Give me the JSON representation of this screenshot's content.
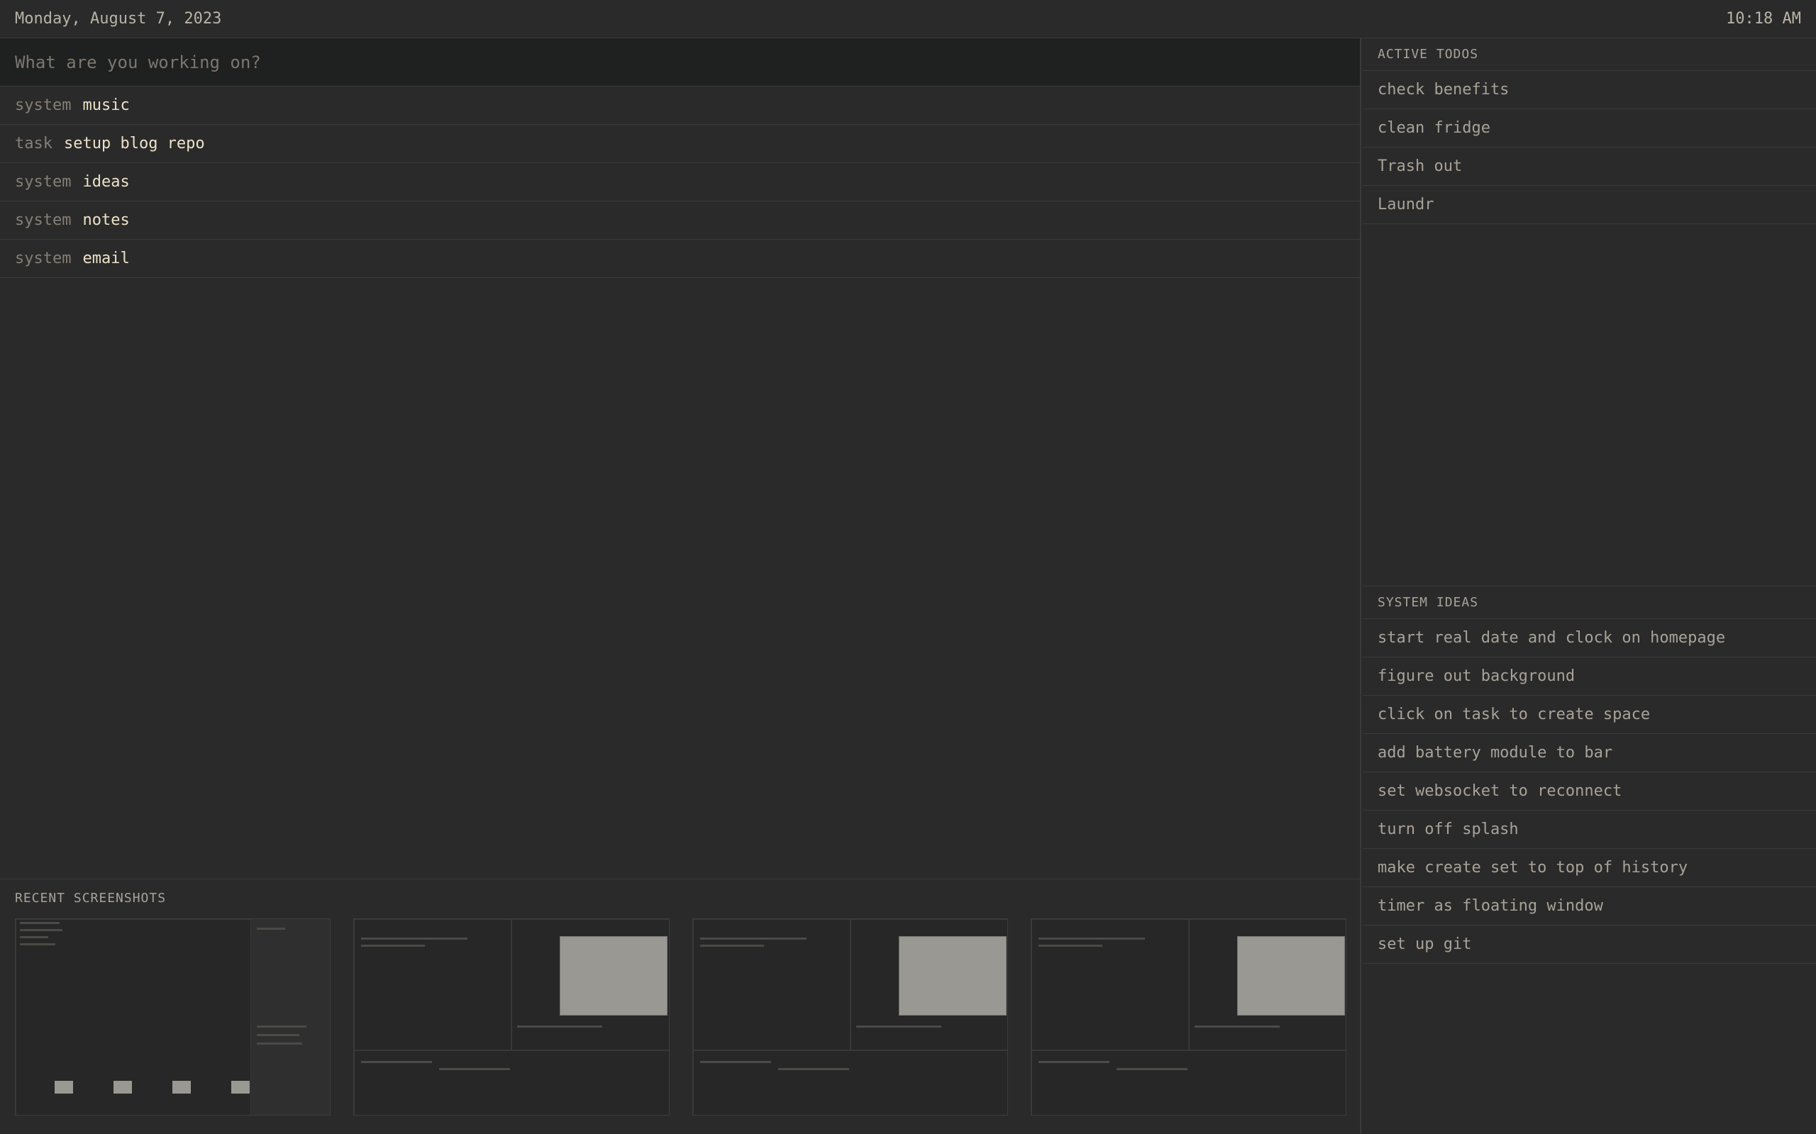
{
  "header": {
    "date": "Monday, August 7, 2023",
    "time": "10:18 AM"
  },
  "search": {
    "placeholder": "What are you working on?",
    "value": ""
  },
  "history": [
    {
      "kind": "system",
      "name": "music"
    },
    {
      "kind": "task",
      "name": "setup blog repo"
    },
    {
      "kind": "system",
      "name": "ideas"
    },
    {
      "kind": "system",
      "name": "notes"
    },
    {
      "kind": "system",
      "name": "email"
    }
  ],
  "screenshots": {
    "title": "RECENT SCREENSHOTS",
    "count": 4
  },
  "todos": {
    "title": "ACTIVE TODOS",
    "items": [
      "check benefits",
      "clean fridge",
      "Trash out",
      "Laundr"
    ]
  },
  "ideas": {
    "title": "SYSTEM IDEAS",
    "items": [
      "start real date and clock on homepage",
      "figure out background",
      "click on task to create space",
      "add battery module to bar",
      "set websocket to reconnect",
      "turn off splash",
      "make create set to top of history",
      "timer as floating window",
      "set up git"
    ]
  },
  "colors": {
    "background": "#2a2a2a",
    "input_background": "#1f2020",
    "divider": "#3a3a3a",
    "highlight_text": "#ece2c8",
    "muted_text": "#857f76"
  }
}
